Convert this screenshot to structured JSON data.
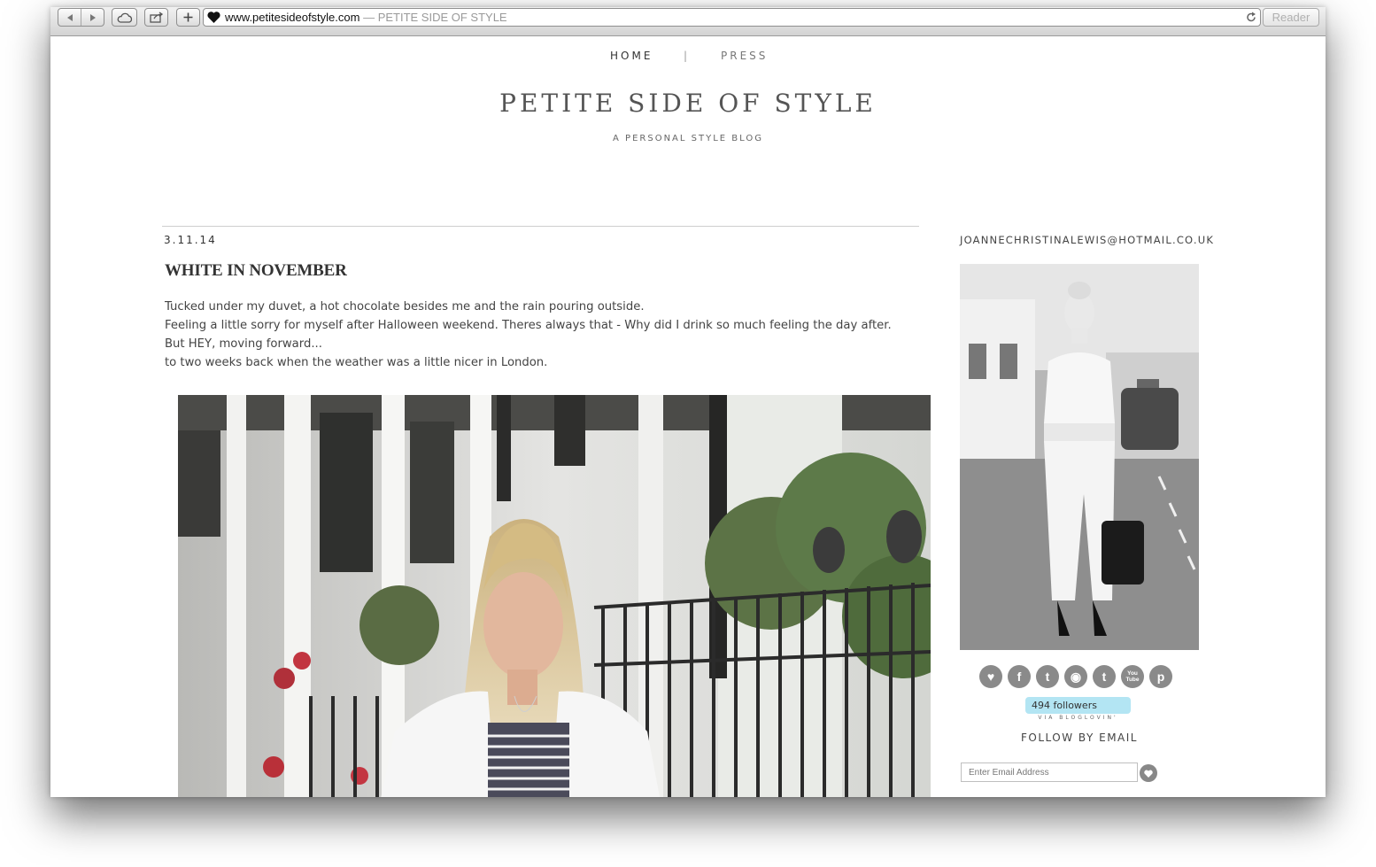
{
  "browser": {
    "url": "www.petitesideofstyle.com",
    "separator": " — ",
    "page_title": "PETITE SIDE OF STYLE",
    "reader_label": "Reader"
  },
  "nav": {
    "items": [
      {
        "label": "HOME"
      },
      {
        "label": "|"
      },
      {
        "label": "PRESS"
      }
    ]
  },
  "site": {
    "title": "PETITE SIDE OF STYLE",
    "tagline": "A PERSONAL STYLE BLOG"
  },
  "post": {
    "date": "3.11.14",
    "title": "WHITE IN NOVEMBER",
    "paragraphs": [
      "Tucked under my duvet, a hot chocolate besides me and the rain pouring outside.",
      "Feeling a little sorry for myself after Halloween weekend. Theres always that - Why did I drink so much feeling the day after.",
      "But HEY, moving forward...",
      "to two weeks back when the weather was a little nicer in London."
    ]
  },
  "sidebar": {
    "email": "JOANNECHRISTINALEWIS@HOTMAIL.CO.UK",
    "socials": [
      {
        "icon": "bloglovin-heart-icon",
        "glyph": "♥"
      },
      {
        "icon": "facebook-icon",
        "glyph": "f"
      },
      {
        "icon": "twitter-icon",
        "glyph": "t"
      },
      {
        "icon": "instagram-icon",
        "glyph": "◉"
      },
      {
        "icon": "tumblr-icon",
        "glyph": "t"
      },
      {
        "icon": "youtube-icon",
        "glyph": "You\nTube"
      },
      {
        "icon": "pinterest-icon",
        "glyph": "p"
      }
    ],
    "followers_text": "494  followers",
    "via_text": "VIA BLOGLOVIN'",
    "follow_by_email": "FOLLOW BY EMAIL",
    "email_placeholder": "Enter Email Address"
  },
  "colors": {
    "followers_badge": "#b3e5f3",
    "social_icon_bg": "#8a8a8a",
    "text": "#444444"
  }
}
